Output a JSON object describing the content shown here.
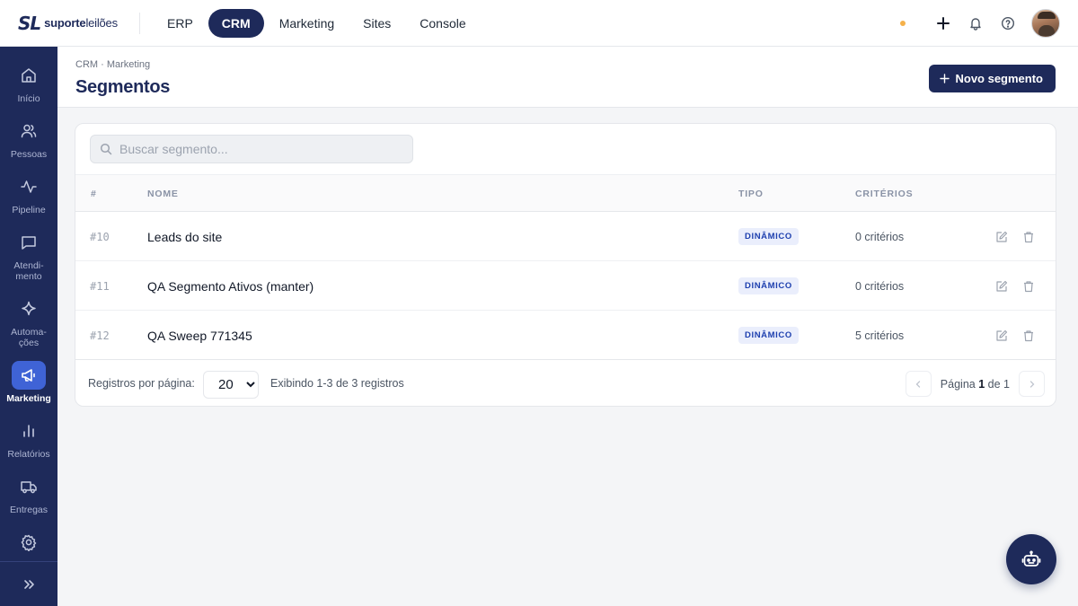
{
  "brand": {
    "mark": "SL",
    "name_bold": "suporte",
    "name_light": "leilões"
  },
  "topnav": [
    {
      "label": "ERP",
      "active": false
    },
    {
      "label": "CRM",
      "active": true
    },
    {
      "label": "Marketing",
      "active": false
    },
    {
      "label": "Sites",
      "active": false
    },
    {
      "label": "Console",
      "active": false
    }
  ],
  "top_actions": {
    "status_color": "#f5b14a",
    "icons": [
      "plus-icon",
      "bell-icon",
      "help-icon"
    ]
  },
  "sidebar": {
    "items": [
      {
        "label": "Início",
        "icon": "home-icon"
      },
      {
        "label": "Pessoas",
        "icon": "users-icon"
      },
      {
        "label": "Pipeline",
        "icon": "activity-icon"
      },
      {
        "label": "Atendi-\nmento",
        "icon": "message-icon"
      },
      {
        "label": "Automa-\nções",
        "icon": "sparkle-icon"
      },
      {
        "label": "Marketing",
        "icon": "megaphone-icon",
        "active": true
      },
      {
        "label": "Relatórios",
        "icon": "bar-chart-icon"
      },
      {
        "label": "Entregas",
        "icon": "truck-icon"
      },
      {
        "label": "",
        "icon": "gear-icon"
      }
    ],
    "expand_icon": "chevrons-right-icon"
  },
  "page": {
    "breadcrumb": "CRM · Marketing",
    "title": "Segmentos",
    "new_button": "Novo segmento"
  },
  "search": {
    "placeholder": "Buscar segmento...",
    "value": ""
  },
  "table": {
    "columns": {
      "id": "#",
      "name": "NOME",
      "type": "TIPO",
      "criteria": "CRITÉRIOS"
    },
    "rows": [
      {
        "id": "#10",
        "name": "Leads do site",
        "type": "DINÂMICO",
        "criteria": "0 critérios"
      },
      {
        "id": "#11",
        "name": "QA Segmento Ativos (manter)",
        "type": "DINÂMICO",
        "criteria": "0 critérios"
      },
      {
        "id": "#12",
        "name": "QA Sweep 771345",
        "type": "DINÂMICO",
        "criteria": "5 critérios"
      }
    ]
  },
  "footer": {
    "per_page_label": "Registros por página:",
    "per_page_value": "20",
    "showing": "Exibindo 1-3 de 3 registros",
    "page_prefix": "Página",
    "page_current": "1",
    "page_of": "de",
    "page_total": "1"
  },
  "colors": {
    "primary": "#1e2a5a",
    "accent": "#3f63d6",
    "badge_bg": "#eaeefc",
    "badge_text": "#1e40af"
  }
}
